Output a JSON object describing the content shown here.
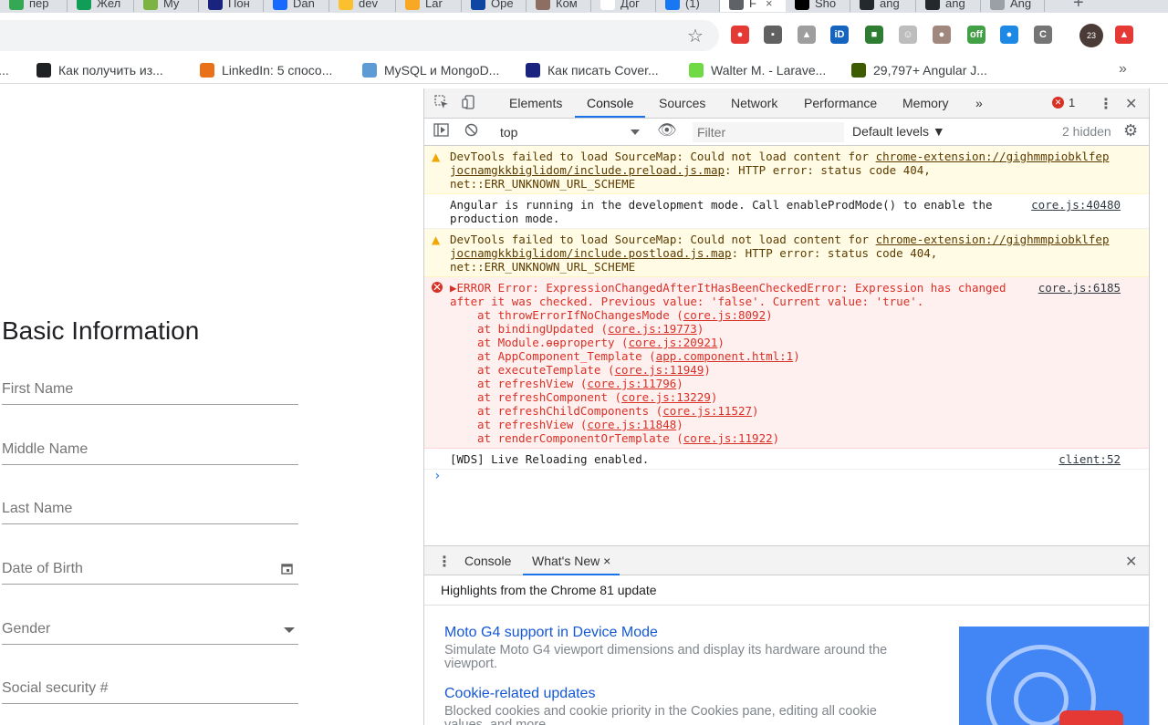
{
  "tabs": [
    {
      "label": "пер",
      "color": "#34a853"
    },
    {
      "label": "Жел",
      "color": "#0f9d58"
    },
    {
      "label": "My",
      "color": "#7cb342"
    },
    {
      "label": "Пон",
      "color": "#1a237e"
    },
    {
      "label": "Dan",
      "color": "#1769ff"
    },
    {
      "label": "dev",
      "color": "#fbc02d"
    },
    {
      "label": "Lar",
      "color": "#f9a825"
    },
    {
      "label": "Ope",
      "color": "#0d47a1"
    },
    {
      "label": "Ком",
      "color": "#8d6e63"
    },
    {
      "label": "Дог",
      "color": "#ffffff"
    },
    {
      "label": "(1)",
      "color": "#1877f2"
    },
    {
      "label": "F",
      "color": "#5f6368",
      "active": true
    },
    {
      "label": "Sho",
      "color": "#000000"
    },
    {
      "label": "ang",
      "color": "#24292e"
    },
    {
      "label": "ang",
      "color": "#24292e"
    },
    {
      "label": "Ang",
      "color": "#9aa0a6"
    }
  ],
  "toolbar": {
    "extensions": [
      {
        "name": "adblock-extension-icon",
        "color": "#e53935",
        "glyph": "●"
      },
      {
        "name": "screen-extension-icon",
        "color": "#616161",
        "glyph": "▪"
      },
      {
        "name": "person-extension-icon",
        "color": "#9e9e9e",
        "glyph": "▲"
      },
      {
        "name": "id-extension-icon",
        "color": "#1565c0",
        "glyph": "iD"
      },
      {
        "name": "green-extension-icon",
        "color": "#2e7d32",
        "glyph": "■"
      },
      {
        "name": "face-extension-icon",
        "color": "#bdbdbd",
        "glyph": "☺"
      },
      {
        "name": "cookie-extension-icon",
        "color": "#a1887f",
        "glyph": "●"
      },
      {
        "name": "off-extension-icon",
        "color": "#43a047",
        "glyph": "off"
      },
      {
        "name": "blue-extension-icon",
        "color": "#1e88e5",
        "glyph": "●"
      },
      {
        "name": "c-extension-icon",
        "color": "#757575",
        "glyph": "C"
      },
      {
        "name": "red-up-extension-icon",
        "color": "#e53935",
        "glyph": "▲"
      }
    ],
    "avatar_text": "23"
  },
  "bookmarks": [
    {
      "label": "к...",
      "color": "#9aa0a6"
    },
    {
      "label": "Как получить из...",
      "color": "#202124"
    },
    {
      "label": "LinkedIn: 5 спосо...",
      "color": "#e8711a"
    },
    {
      "label": "MySQL и MongoD...",
      "color": "#5c9bd5"
    },
    {
      "label": "Как писать Cover...",
      "color": "#1a237e"
    },
    {
      "label": "Walter M. - Larave...",
      "color": "#6fda44"
    },
    {
      "label": "29,797+ Angular J...",
      "color": "#3d5c00"
    }
  ],
  "form": {
    "title": "Basic Information",
    "fields": [
      {
        "label": "First Name"
      },
      {
        "label": "Middle Name"
      },
      {
        "label": "Last Name"
      },
      {
        "label": "Date of Birth"
      },
      {
        "label": "Gender"
      },
      {
        "label": "Social security #"
      }
    ]
  },
  "devtools": {
    "tabs": [
      "Elements",
      "Console",
      "Sources",
      "Network",
      "Performance",
      "Memory"
    ],
    "active_tab": "Console",
    "more": "»",
    "error_count": "1",
    "context": "top",
    "filter_placeholder": "Filter",
    "levels": "Default levels ▼",
    "hidden": "2 hidden",
    "messages": {
      "warn1": {
        "pre": "DevTools failed to load SourceMap: Could not load content for ",
        "link1": "chrome-extension://gighmmpiobklfep",
        "link2": "jocnamgkkbiglidom/include.preload.js.map",
        "post": ": HTTP error: status code 404,",
        "line3": "net::ERR_UNKNOWN_URL_SCHEME"
      },
      "info1": {
        "text": "Angular is running in the development mode. Call enableProdMode() to enable the",
        "text2": "production mode.",
        "src": "core.js:40480"
      },
      "warn2": {
        "pre": "DevTools failed to load SourceMap: Could not load content for ",
        "link1": "chrome-extension://gighmmpiobklfep",
        "link2": "jocnamgkkbiglidom/include.postload.js.map",
        "post": ": HTTP error: status code 404,",
        "line3": "net::ERR_UNKNOWN_URL_SCHEME"
      },
      "error1": {
        "text": "▶ERROR Error: ExpressionChangedAfterItHasBeenCheckedError: Expression has changed",
        "text2": "after it was checked. Previous value: 'false'. Current value: 'true'.",
        "src": "core.js:6185",
        "stack": [
          {
            "fn": "at throwErrorIfNoChangesMode (",
            "loc": "core.js:8092",
            "end": ")"
          },
          {
            "fn": "at bindingUpdated (",
            "loc": "core.js:19773",
            "end": ")"
          },
          {
            "fn": "at Module.ɵɵproperty (",
            "loc": "core.js:20921",
            "end": ")"
          },
          {
            "fn": "at AppComponent_Template (",
            "loc": "app.component.html:1",
            "end": ")"
          },
          {
            "fn": "at executeTemplate (",
            "loc": "core.js:11949",
            "end": ")"
          },
          {
            "fn": "at refreshView (",
            "loc": "core.js:11796",
            "end": ")"
          },
          {
            "fn": "at refreshComponent (",
            "loc": "core.js:13229",
            "end": ")"
          },
          {
            "fn": "at refreshChildComponents (",
            "loc": "core.js:11527",
            "end": ")"
          },
          {
            "fn": "at refreshView (",
            "loc": "core.js:11848",
            "end": ")"
          },
          {
            "fn": "at renderComponentOrTemplate (",
            "loc": "core.js:11922",
            "end": ")"
          }
        ]
      },
      "info2": {
        "text": "[WDS] Live Reloading enabled.",
        "src": "client:52"
      }
    },
    "prompt": "›",
    "drawer": {
      "tabs": [
        "Console",
        "What's New"
      ],
      "close": "×",
      "header": "Highlights from the Chrome 81 update",
      "items": [
        {
          "title": "Moto G4 support in Device Mode",
          "desc": "Simulate Moto G4 viewport dimensions and display its hardware around the viewport."
        },
        {
          "title": "Cookie-related updates",
          "desc": "Blocked cookies and cookie priority in the Cookies pane, editing all cookie values, and more."
        }
      ]
    }
  }
}
